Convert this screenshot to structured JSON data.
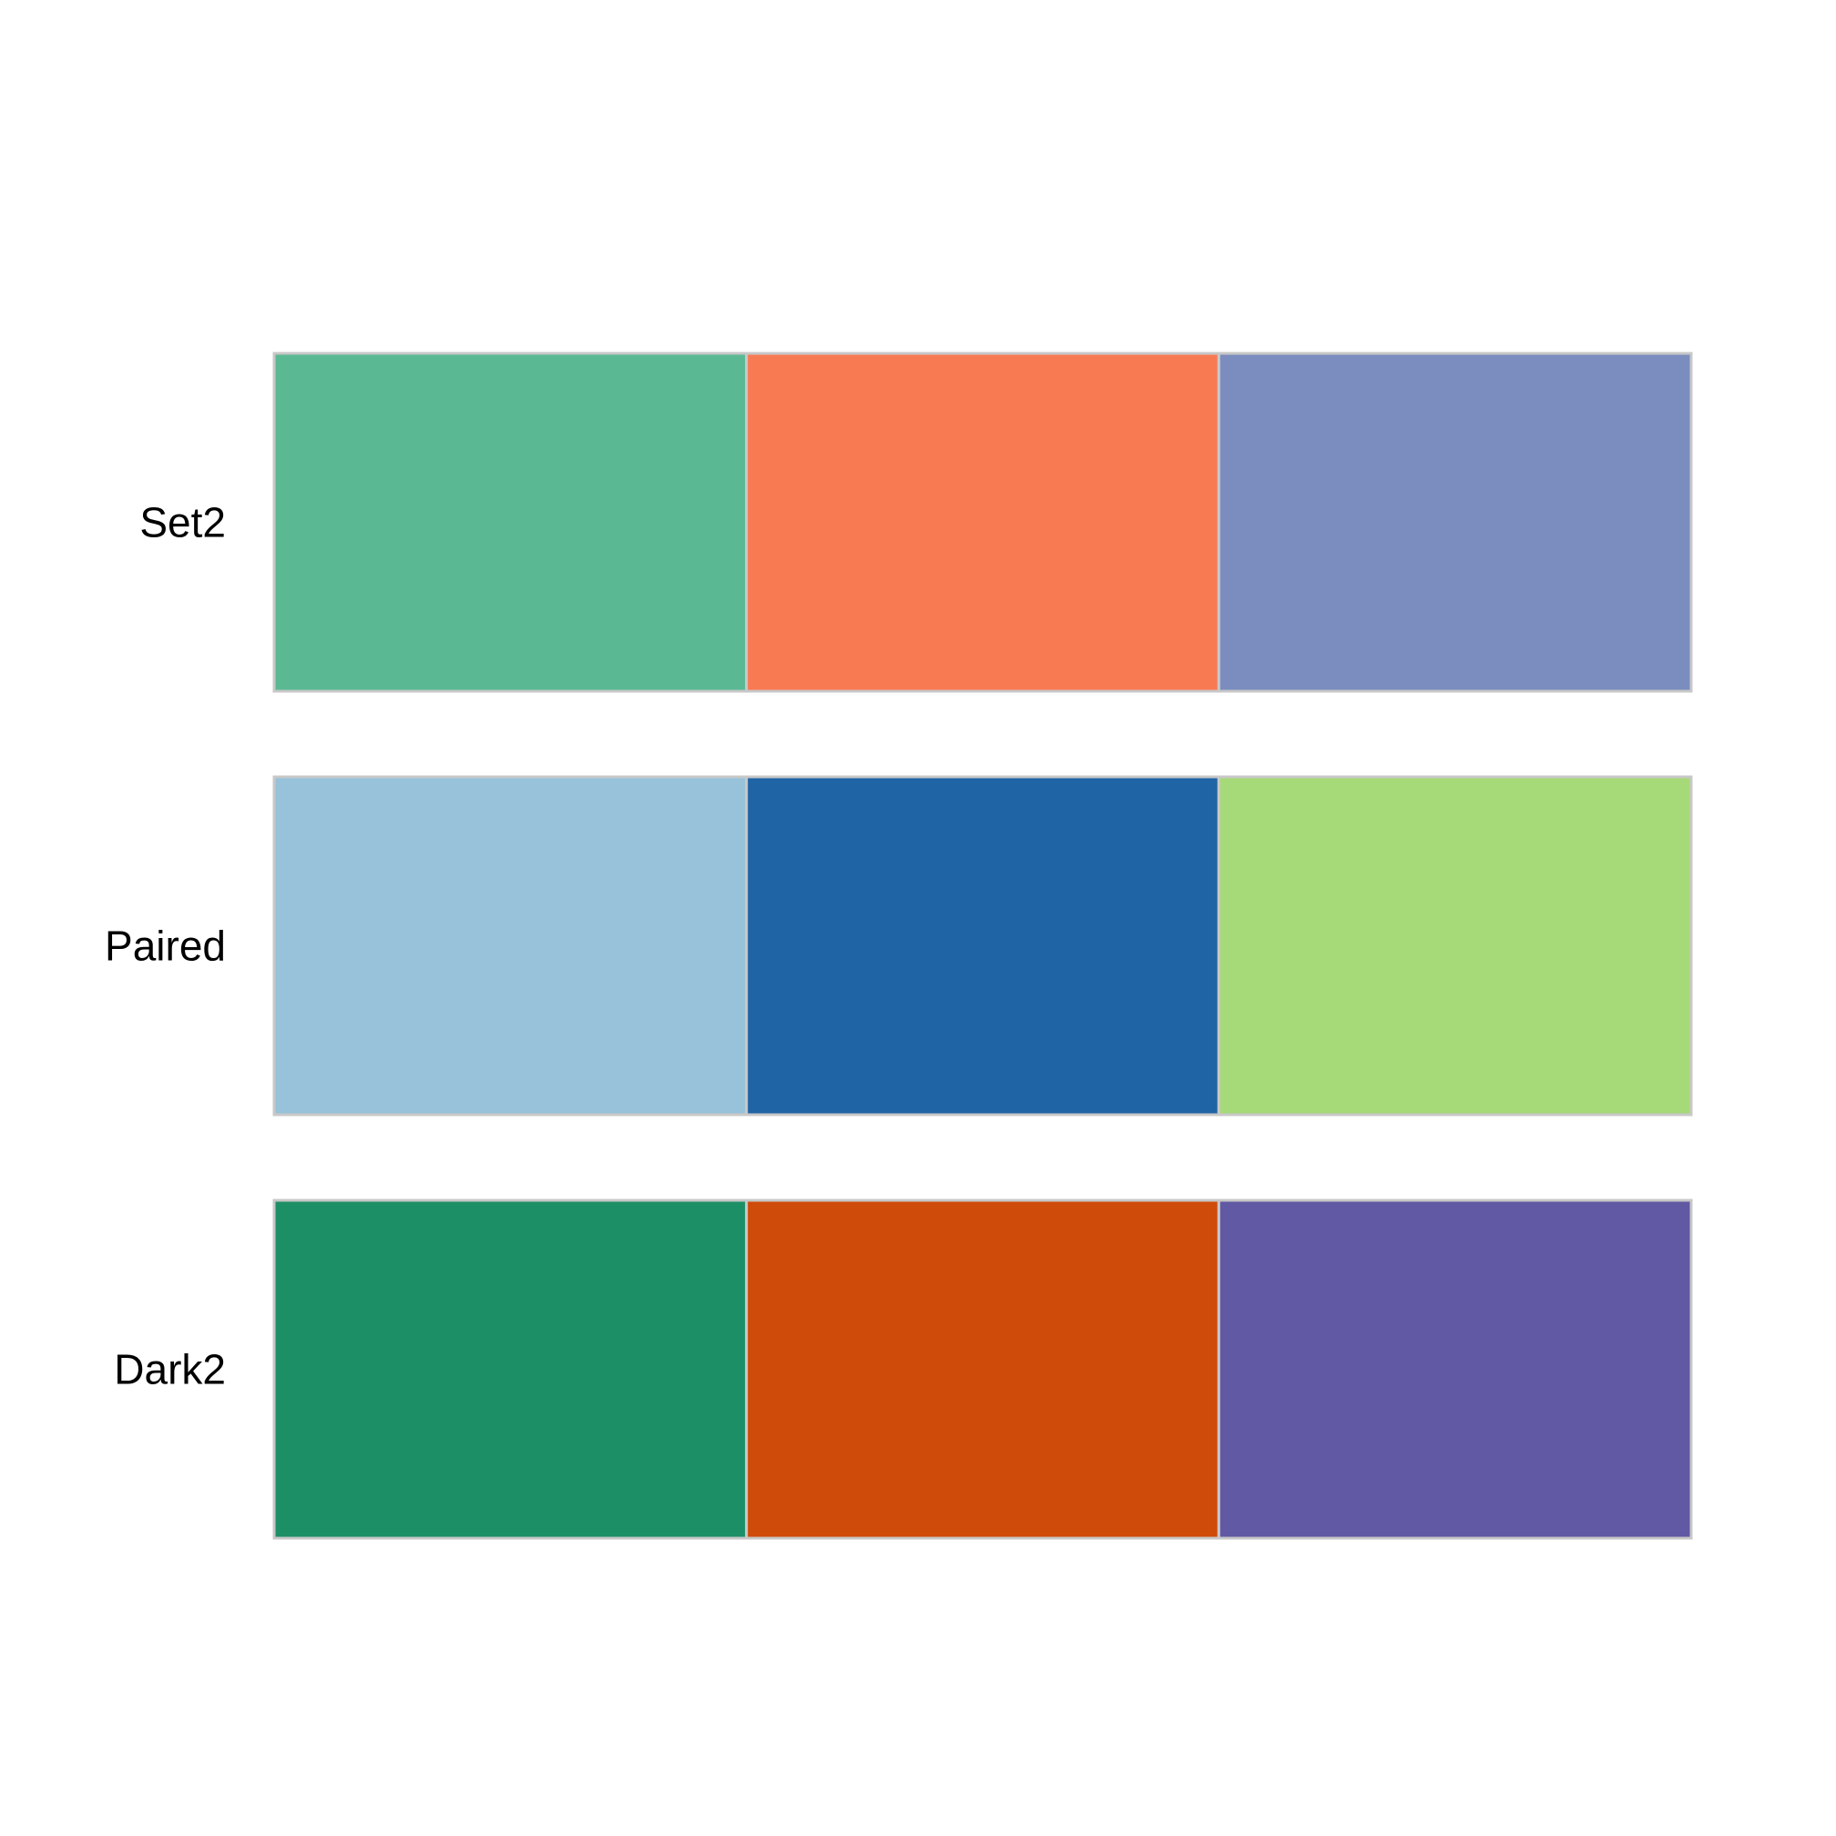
{
  "chart_data": {
    "type": "heatmap",
    "title": "",
    "xlabel": "",
    "ylabel": "",
    "grid": false,
    "categories": [
      "Set2",
      "Paired",
      "Dark2"
    ],
    "palettes": [
      {
        "name": "Set2",
        "colors": [
          "#5ab993",
          "#f87a53",
          "#7b8dbe"
        ]
      },
      {
        "name": "Paired",
        "colors": [
          "#97c2da",
          "#1f64a5",
          "#a6d978"
        ]
      },
      {
        "name": "Dark2",
        "colors": [
          "#1d8f66",
          "#cf4b09",
          "#6159a3"
        ]
      }
    ]
  }
}
